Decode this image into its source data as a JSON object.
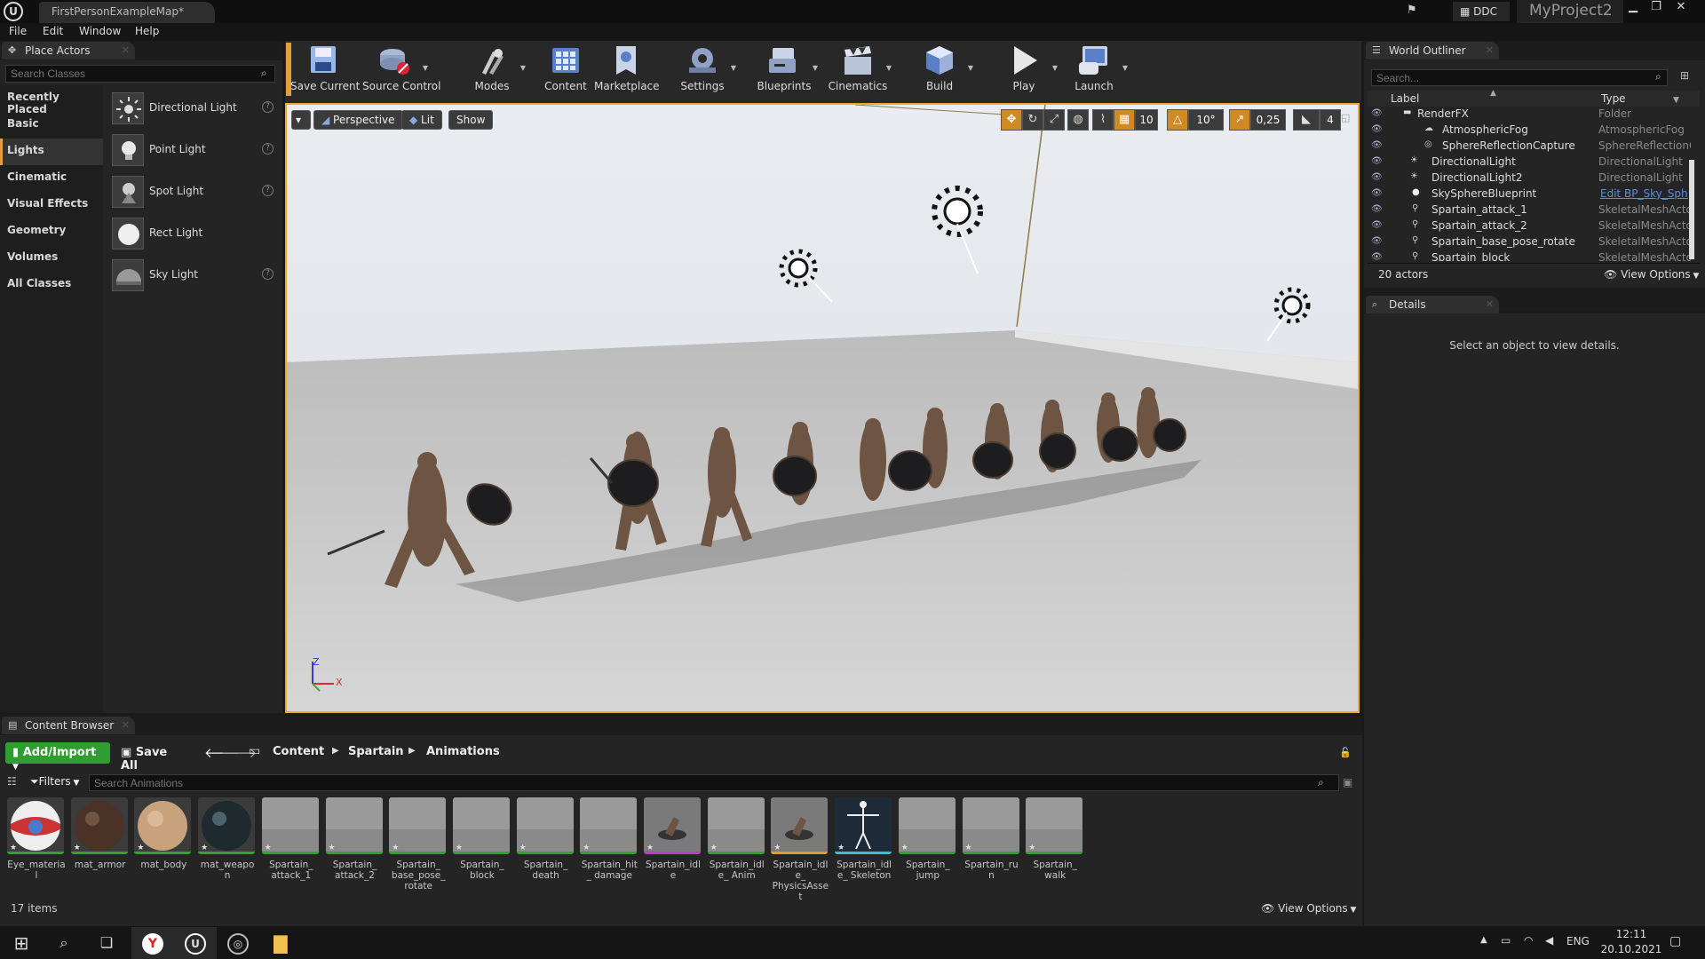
{
  "window": {
    "doc_tab": "FirstPersonExampleMap*",
    "ddc": "DDC",
    "project": "MyProject2"
  },
  "menu": [
    "File",
    "Edit",
    "Window",
    "Help"
  ],
  "place_actors": {
    "tab": "Place Actors",
    "search_placeholder": "Search Classes",
    "categories": [
      "Recently Placed",
      "Basic",
      "Lights",
      "Cinematic",
      "Visual Effects",
      "Geometry",
      "Volumes",
      "All Classes"
    ],
    "selected_category": "Lights",
    "items": [
      {
        "label": "Directional Light",
        "icon": "sun-icon"
      },
      {
        "label": "Point Light",
        "icon": "bulb-icon"
      },
      {
        "label": "Spot Light",
        "icon": "spot-light-icon"
      },
      {
        "label": "Rect Light",
        "icon": "rect-light-icon"
      },
      {
        "label": "Sky Light",
        "icon": "sky-light-icon"
      }
    ]
  },
  "toolbar": [
    {
      "label": "Save Current",
      "icon": "save-icon",
      "dropdown": false
    },
    {
      "label": "Source Control",
      "icon": "source-control-icon",
      "dropdown": true
    },
    {
      "label": "Modes",
      "icon": "modes-icon",
      "dropdown": true
    },
    {
      "label": "Content",
      "icon": "content-icon",
      "dropdown": false
    },
    {
      "label": "Marketplace",
      "icon": "marketplace-icon",
      "dropdown": false
    },
    {
      "label": "Settings",
      "icon": "settings-icon",
      "dropdown": true
    },
    {
      "label": "Blueprints",
      "icon": "blueprints-icon",
      "dropdown": true
    },
    {
      "label": "Cinematics",
      "icon": "cinematics-icon",
      "dropdown": true
    },
    {
      "label": "Build",
      "icon": "build-icon",
      "dropdown": true
    },
    {
      "label": "Play",
      "icon": "play-icon",
      "dropdown": true
    },
    {
      "label": "Launch",
      "icon": "launch-icon",
      "dropdown": true
    }
  ],
  "viewport": {
    "perspective": "Perspective",
    "lit": "Lit",
    "show": "Show",
    "grid_snap": "10",
    "rotation_snap": "10°",
    "scale_snap": "0,25",
    "camera_speed": "4",
    "axis_z": "Z",
    "axis_x": "X"
  },
  "outliner": {
    "tab": "World Outliner",
    "search_placeholder": "Search...",
    "col_label": "Label",
    "col_type": "Type",
    "rows": [
      {
        "name": "RenderFX",
        "type": "Folder",
        "indent": 1
      },
      {
        "name": "AtmosphericFog",
        "type": "AtmosphericFog",
        "indent": 2
      },
      {
        "name": "SphereReflectionCapture",
        "type": "SphereReflectionC",
        "indent": 2
      },
      {
        "name": "DirectionalLight",
        "type": "DirectionalLight",
        "indent": 1
      },
      {
        "name": "DirectionalLight2",
        "type": "DirectionalLight",
        "indent": 1
      },
      {
        "name": "SkySphereBlueprint",
        "type": "Edit BP_Sky_Sph",
        "indent": 1
      },
      {
        "name": "Spartain_attack_1",
        "type": "SkeletalMeshActo",
        "indent": 1
      },
      {
        "name": "Spartain_attack_2",
        "type": "SkeletalMeshActo",
        "indent": 1
      },
      {
        "name": "Spartain_base_pose_rotate",
        "type": "SkeletalMeshActo",
        "indent": 1
      },
      {
        "name": "Spartain_block",
        "type": "SkeletalMeshActo",
        "indent": 1
      }
    ],
    "count": "20 actors",
    "view_options": "View Options"
  },
  "details": {
    "tab": "Details",
    "empty": "Select an object to view details."
  },
  "content_browser": {
    "tab": "Content Browser",
    "add_import": "Add/Import",
    "save_all": "Save All",
    "path": [
      "Content",
      "Spartain",
      "Animations"
    ],
    "filters": "Filters",
    "search_placeholder": "Search Animations",
    "assets": [
      {
        "name": "Eye_material",
        "kind": "eye"
      },
      {
        "name": "mat_armor",
        "kind": "armor"
      },
      {
        "name": "mat_body",
        "kind": "body"
      },
      {
        "name": "mat_weapon",
        "kind": "weapon"
      },
      {
        "name": "Spartain_ attack_1",
        "kind": "anim"
      },
      {
        "name": "Spartain_ attack_2",
        "kind": "anim"
      },
      {
        "name": "Spartain_ base_pose_ rotate",
        "kind": "anim"
      },
      {
        "name": "Spartain_ block",
        "kind": "anim"
      },
      {
        "name": "Spartain_ death",
        "kind": "anim"
      },
      {
        "name": "Spartain_hit_ damage",
        "kind": "anim"
      },
      {
        "name": "Spartain_idle",
        "kind": "mesh"
      },
      {
        "name": "Spartain_idle_ Anim",
        "kind": "anim"
      },
      {
        "name": "Spartain_idle_ PhysicsAsset",
        "kind": "physics"
      },
      {
        "name": "Spartain_idle_ Skeleton",
        "kind": "skeleton"
      },
      {
        "name": "Spartain_ jump",
        "kind": "anim"
      },
      {
        "name": "Spartain_run",
        "kind": "anim"
      },
      {
        "name": "Spartain_ walk",
        "kind": "anim"
      }
    ],
    "count": "17 items",
    "view_options": "View Options"
  },
  "taskbar": {
    "lang": "ENG",
    "time": "12:11",
    "date": "20.10.2021"
  }
}
